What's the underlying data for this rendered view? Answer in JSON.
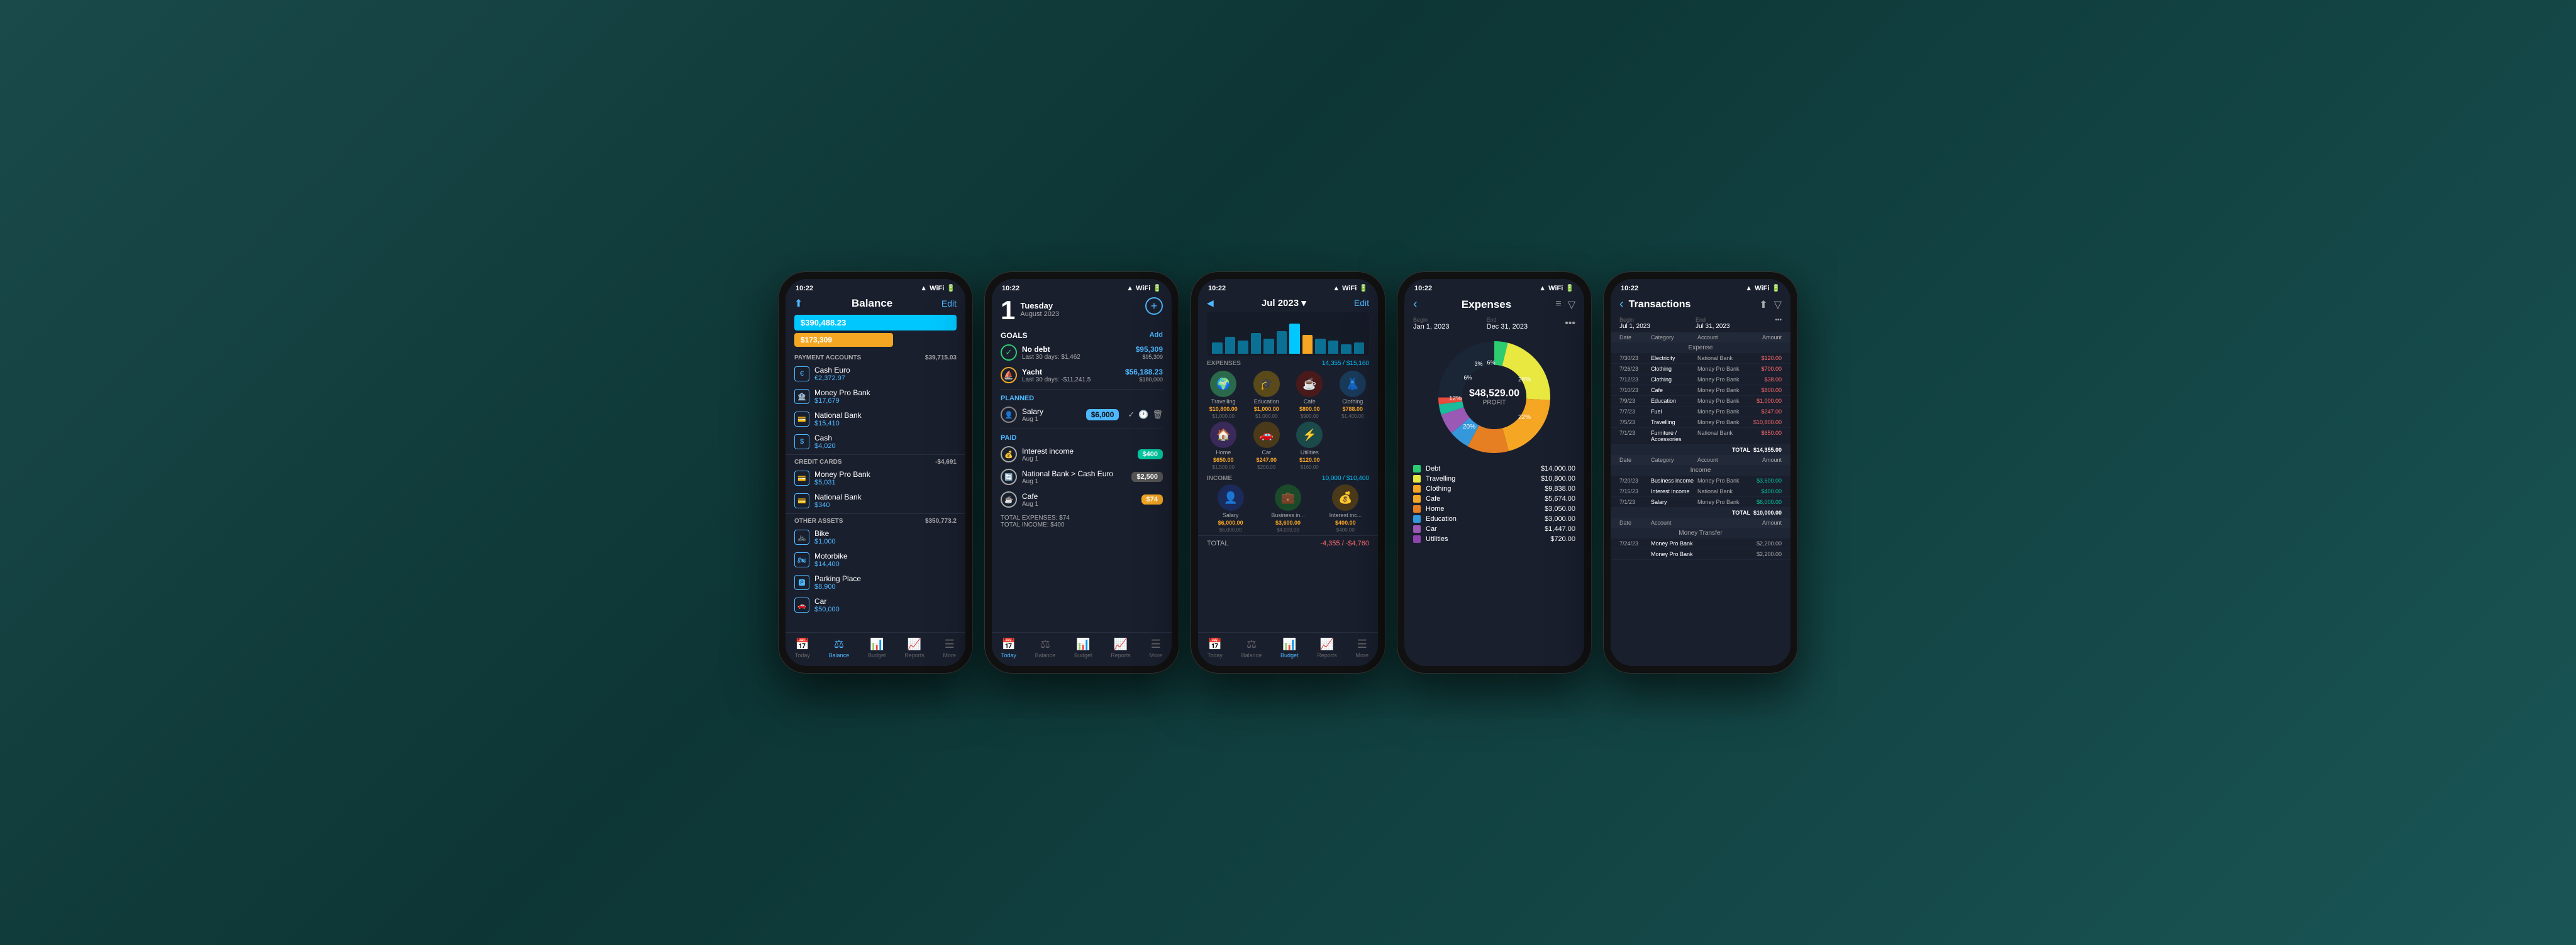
{
  "phones": [
    {
      "id": "balance",
      "status_time": "10:22",
      "header": {
        "title": "Balance",
        "edit": "Edit",
        "share": "⬆"
      },
      "balance_primary": "$390,488.23",
      "balance_secondary": "$173,309",
      "sections": [
        {
          "title": "PAYMENT ACCOUNTS",
          "total": "$39,715.03",
          "accounts": [
            {
              "icon": "€",
              "name": "Cash Euro",
              "value": "€2,372.97"
            },
            {
              "icon": "🏦",
              "name": "Money Pro Bank",
              "value": "$17,679"
            },
            {
              "icon": "💳",
              "name": "National Bank",
              "value": "$15,410"
            },
            {
              "icon": "$",
              "name": "Cash",
              "value": "$4,020"
            }
          ]
        },
        {
          "title": "CREDIT CARDS",
          "total": "-$4,691",
          "accounts": [
            {
              "icon": "💳",
              "name": "Money Pro Bank",
              "value": "$5,031"
            },
            {
              "icon": "💳",
              "name": "National Bank",
              "value": "$340"
            }
          ]
        },
        {
          "title": "OTHER ASSETS",
          "total": "$350,773.2",
          "accounts": [
            {
              "icon": "🚲",
              "name": "Bike",
              "value": "$1,000"
            },
            {
              "icon": "🏍",
              "name": "Motorbike",
              "value": "$14,400"
            },
            {
              "icon": "🅿",
              "name": "Parking Place",
              "value": "$8,900"
            },
            {
              "icon": "🚗",
              "name": "Car",
              "value": "$50,000"
            }
          ]
        }
      ],
      "nav": [
        {
          "label": "Today",
          "icon": "📅",
          "active": false
        },
        {
          "label": "Balance",
          "icon": "⚖",
          "active": true
        },
        {
          "label": "Budget",
          "icon": "📊",
          "active": false
        },
        {
          "label": "Reports",
          "icon": "📈",
          "active": false
        },
        {
          "label": "More",
          "icon": "☰",
          "active": false
        }
      ]
    },
    {
      "id": "today",
      "status_time": "10:22",
      "date_num": "1",
      "date_day": "Tuesday",
      "date_month": "August 2023",
      "goals_title": "GOALS",
      "goals_add": "Add",
      "goals": [
        {
          "icon": "✓",
          "name": "No debt",
          "sub": "Last 30 days: $1,462",
          "amount": "$95,309",
          "amount2": "$95,309"
        },
        {
          "icon": "⛵",
          "name": "Yacht",
          "sub": "Last 30 days: -$11,241.5",
          "amount": "$56,188.23",
          "amount2": "$180,000"
        }
      ],
      "planned_title": "PLANNED",
      "planned": [
        {
          "icon": "👤",
          "name": "Salary",
          "sub": "Aug 1",
          "badge": "$6,000",
          "badge_type": "blue"
        }
      ],
      "paid_title": "PAID",
      "paid": [
        {
          "icon": "💰",
          "name": "Interest income",
          "sub": "Aug 1",
          "badge": "$400",
          "badge_type": "green"
        },
        {
          "icon": "🔄",
          "name": "National Bank > Cash Euro",
          "sub": "Aug 1",
          "badge": "$2,500",
          "badge_type": "gray"
        },
        {
          "icon": "☕",
          "name": "Cafe",
          "sub": "Aug 1",
          "badge": "$74",
          "badge_type": "yellow"
        }
      ],
      "total_expenses": "TOTAL EXPENSES: $74",
      "total_income": "TOTAL INCOME: $400",
      "nav": [
        {
          "label": "Today",
          "icon": "📅",
          "active": true
        },
        {
          "label": "Balance",
          "icon": "⚖",
          "active": false
        },
        {
          "label": "Budget",
          "icon": "📊",
          "active": false
        },
        {
          "label": "Reports",
          "icon": "📈",
          "active": false
        },
        {
          "label": "More",
          "icon": "☰",
          "active": false
        }
      ]
    },
    {
      "id": "budget",
      "status_time": "10:22",
      "month": "Jul 2023 ▾",
      "edit": "Edit",
      "expenses_label": "EXPENSES",
      "expenses_total": "14,355 / $15,160",
      "expenses": [
        {
          "emoji": "🌍",
          "name": "Travelling",
          "val1": "$10,800.00",
          "val2": "$1,000.00",
          "color": "#3a9"
        },
        {
          "emoji": "🎓",
          "name": "Education",
          "val1": "$1,000.00",
          "val2": "$1,000.00",
          "color": "#f5a623"
        },
        {
          "emoji": "☕",
          "name": "Cafe",
          "val1": "$800.00",
          "val2": "$900.00",
          "color": "#c0392b"
        },
        {
          "emoji": "👗",
          "name": "Clothing",
          "val1": "$788.00",
          "val2": "$1,400.00",
          "color": "#3498db"
        },
        {
          "emoji": "🏠",
          "name": "Home",
          "val1": "$650.00",
          "val2": "$1,500.00",
          "color": "#9b59b6"
        },
        {
          "emoji": "🚗",
          "name": "Car",
          "val1": "$247.00",
          "val2": "$200.00",
          "color": "#e67e22"
        },
        {
          "emoji": "⚡",
          "name": "Utilities",
          "val1": "$120.00",
          "val2": "$160.00",
          "color": "#1abc9c"
        }
      ],
      "income_label": "INCOME",
      "income_total": "10,000 / $10,400",
      "income": [
        {
          "emoji": "👤",
          "name": "Salary",
          "val1": "$6,000.00",
          "val2": "$6,000.00",
          "color": "#3498db"
        },
        {
          "emoji": "💼",
          "name": "Business in...",
          "val1": "$3,600.00",
          "val2": "$4,000.00",
          "color": "#2ecc71"
        },
        {
          "emoji": "💰",
          "name": "Interest inc...",
          "val1": "$400.00",
          "val2": "$400.00",
          "color": "#f5a623"
        }
      ],
      "total_label": "TOTAL",
      "total_val": "-4,355 / -$4,760",
      "nav": [
        {
          "label": "Today",
          "icon": "📅",
          "active": false
        },
        {
          "label": "Balance",
          "icon": "⚖",
          "active": false
        },
        {
          "label": "Budget",
          "icon": "📊",
          "active": true
        },
        {
          "label": "Reports",
          "icon": "📈",
          "active": false
        },
        {
          "label": "More",
          "icon": "☰",
          "active": false
        }
      ]
    },
    {
      "id": "expenses",
      "status_time": "10:22",
      "back": "‹",
      "title": "Expenses",
      "date_begin_label": "Begin",
      "date_begin_val": "Jan 1, 2023",
      "date_end_label": "End",
      "date_end_val": "Dec 31, 2023",
      "profit": "$48,529.00",
      "profit_label": "PROFIT",
      "legend": [
        {
          "name": "Debt",
          "value": "$14,000.00",
          "color": "#2ecc71"
        },
        {
          "name": "Travelling",
          "value": "$10,800.00",
          "color": "#f5a623"
        },
        {
          "name": "Clothing",
          "value": "$9,838.00",
          "color": "#f5a623"
        },
        {
          "name": "Cafe",
          "value": "$5,674.00",
          "color": "#f5a623"
        },
        {
          "name": "Home",
          "value": "$3,050.00",
          "color": "#e67e22"
        },
        {
          "name": "Education",
          "value": "$3,000.00",
          "color": "#3498db"
        },
        {
          "name": "Car",
          "value": "$1,447.00",
          "color": "#9b59b6"
        },
        {
          "name": "Utilities",
          "value": "$720.00",
          "color": "#8e44ad"
        }
      ],
      "donut_segments": [
        {
          "color": "#2ecc71",
          "pct": 29
        },
        {
          "color": "#e8e840",
          "pct": 22
        },
        {
          "color": "#f5a623",
          "pct": 20
        },
        {
          "color": "#e67e22",
          "pct": 12
        },
        {
          "color": "#3498db",
          "pct": 6
        },
        {
          "color": "#9b59b6",
          "pct": 6
        },
        {
          "color": "#1abc9c",
          "pct": 3
        },
        {
          "color": "#e74c3c",
          "pct": 2
        }
      ],
      "donut_labels": [
        {
          "pct": "29%",
          "angle": 315
        },
        {
          "pct": "22%",
          "angle": 50
        },
        {
          "pct": "20%",
          "angle": 130
        },
        {
          "pct": "12%",
          "angle": 185
        },
        {
          "pct": "6%",
          "angle": 222
        },
        {
          "pct": "6%",
          "angle": 255
        },
        {
          "pct": "3%",
          "angle": 285
        }
      ]
    },
    {
      "id": "transactions",
      "status_time": "10:22",
      "back": "‹",
      "title": "Transactions",
      "date_begin_label": "Begin",
      "date_begin_val": "Jul 1, 2023",
      "date_end_label": "End",
      "date_end_val": "Jul 31, 2023",
      "expense_rows": [
        {
          "date": "7/30/23",
          "cat": "Electricity",
          "acc": "National Bank",
          "amt": "$120.00"
        },
        {
          "date": "7/26/23",
          "cat": "Clothing",
          "acc": "Money Pro Bank",
          "amt": "$700.00"
        },
        {
          "date": "7/12/23",
          "cat": "Clothing",
          "acc": "Money Pro Bank",
          "amt": "$38.00"
        },
        {
          "date": "7/10/23",
          "cat": "Cafe",
          "acc": "Money Pro Bank",
          "amt": "$800.00"
        },
        {
          "date": "7/9/23",
          "cat": "Education",
          "acc": "Money Pro Bank",
          "amt": "$1,000.00"
        },
        {
          "date": "7/7/23",
          "cat": "Fuel",
          "acc": "Money Pro Bank",
          "amt": "$247.00"
        },
        {
          "date": "7/5/23",
          "cat": "Travelling",
          "acc": "Money Pro Bank",
          "amt": "$10,800.00"
        },
        {
          "date": "7/1/23",
          "cat": "Furniture / Accessories",
          "acc": "National Bank",
          "amt": "$650.00"
        }
      ],
      "expense_total": "$14,355.00",
      "income_rows": [
        {
          "date": "7/20/23",
          "cat": "Business income",
          "acc": "Money Pro Bank",
          "amt": "$3,600.00"
        },
        {
          "date": "7/15/23",
          "cat": "Interest income",
          "acc": "National Bank",
          "amt": "$400.00"
        },
        {
          "date": "7/1/23",
          "cat": "Salary",
          "acc": "Money Pro Bank",
          "amt": "$6,000.00"
        }
      ],
      "income_total": "$10,000.00",
      "transfer_rows": [
        {
          "date": "7/24/23",
          "cat": "Money Pro Bank",
          "amt": "$2,200.00"
        },
        {
          "date": "",
          "cat": "Money Pro Bank",
          "amt": "$2,200.00"
        }
      ]
    }
  ]
}
